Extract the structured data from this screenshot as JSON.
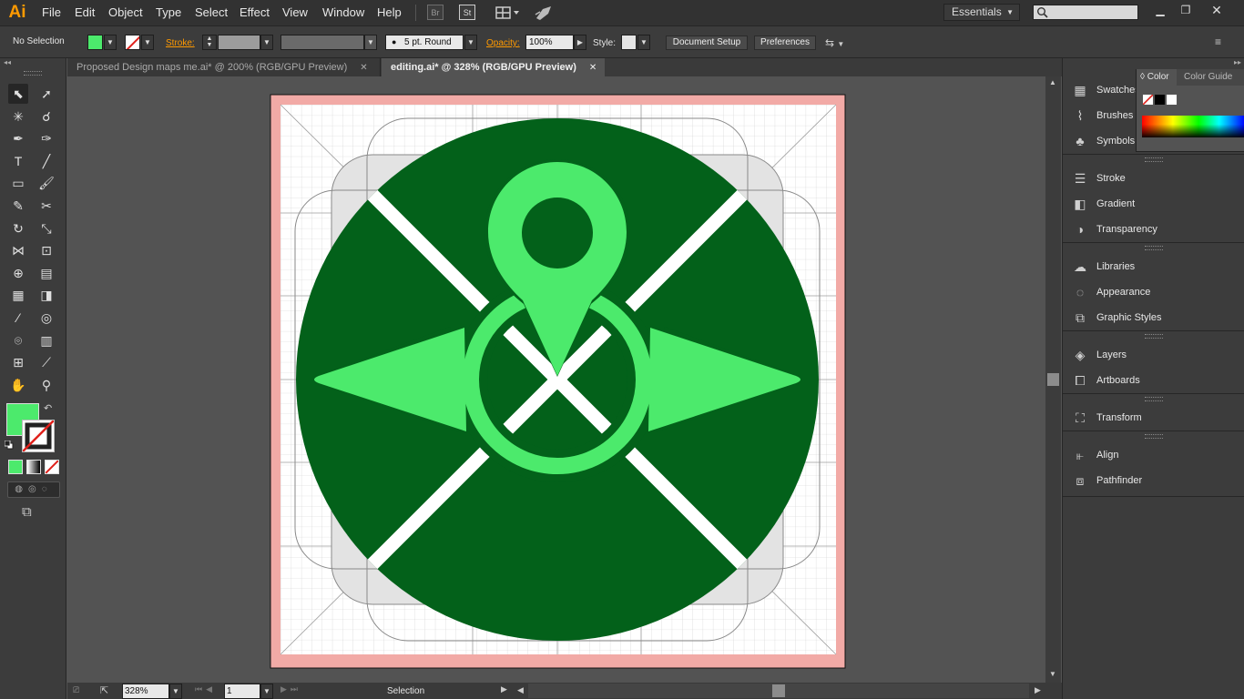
{
  "app": {
    "logo": "Ai",
    "accent": "#ff9a00"
  },
  "menu": [
    "File",
    "Edit",
    "Object",
    "Type",
    "Select",
    "Effect",
    "View",
    "Window",
    "Help"
  ],
  "menubar_buttons": {
    "bridge": "Br",
    "stock": "St"
  },
  "workspace": {
    "label": "Essentials"
  },
  "control": {
    "selection_label": "No Selection",
    "fill_color": "#4cea6c",
    "stroke_label": "Stroke:",
    "brush_label": "5 pt. Round",
    "opacity_label": "Opacity:",
    "opacity_value": "100%",
    "style_label": "Style:",
    "document_setup": "Document Setup",
    "preferences": "Preferences"
  },
  "tabs": [
    {
      "label": "Proposed Design maps me.ai* @ 200% (RGB/GPU Preview)",
      "active": false
    },
    {
      "label": "editing.ai* @ 328% (RGB/GPU Preview)",
      "active": true
    }
  ],
  "status": {
    "zoom": "328%",
    "artboard": "1",
    "tool": "Selection"
  },
  "panels": [
    {
      "name": "Swatches",
      "icon": "swatches-icon"
    },
    {
      "name": "Brushes",
      "icon": "brush-icon"
    },
    {
      "name": "Symbols",
      "icon": "club-icon"
    },
    {
      "name": "Stroke",
      "icon": "stroke-icon"
    },
    {
      "name": "Gradient",
      "icon": "gradient-icon"
    },
    {
      "name": "Transparency",
      "icon": "transparency-icon"
    },
    {
      "name": "Libraries",
      "icon": "cloud-icon"
    },
    {
      "name": "Appearance",
      "icon": "appearance-icon"
    },
    {
      "name": "Graphic Styles",
      "icon": "graphic-styles-icon"
    },
    {
      "name": "Layers",
      "icon": "layers-icon"
    },
    {
      "name": "Artboards",
      "icon": "artboard-icon"
    },
    {
      "name": "Transform",
      "icon": "transform-icon"
    },
    {
      "name": "Align",
      "icon": "align-icon"
    },
    {
      "name": "Pathfinder",
      "icon": "pathfinder-icon"
    }
  ],
  "color_panel": {
    "tab_color": "Color",
    "tab_guide": "Color Guide"
  },
  "artwork": {
    "background": "#03611a",
    "accent": "#4cea6c",
    "bleed": "#f2aaa6"
  }
}
